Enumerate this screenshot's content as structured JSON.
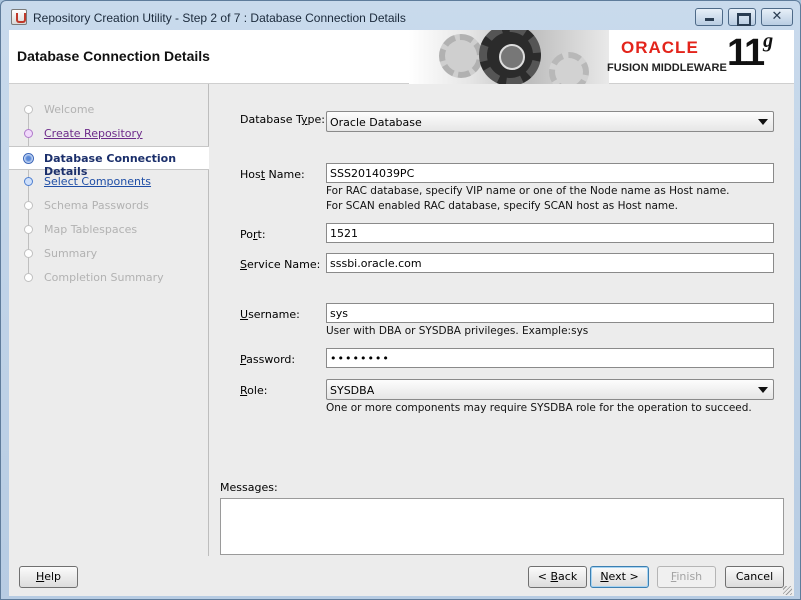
{
  "window": {
    "title": "Repository Creation Utility - Step 2 of 7 : Database Connection Details",
    "close_glyph": "✕"
  },
  "header": {
    "page_title": "Database Connection Details",
    "brand": "ORACLE",
    "product": "FUSION MIDDLEWARE",
    "version_major": "11",
    "version_suffix": "g"
  },
  "nav": {
    "items": [
      {
        "label": "Welcome",
        "state": "disabled"
      },
      {
        "label": "Create Repository",
        "state": "done"
      },
      {
        "label": "Database Connection Details",
        "state": "current"
      },
      {
        "label": "Select Components",
        "state": "next"
      },
      {
        "label": "Schema Passwords",
        "state": "disabled"
      },
      {
        "label": "Map Tablespaces",
        "state": "disabled"
      },
      {
        "label": "Summary",
        "state": "disabled"
      },
      {
        "label": "Completion Summary",
        "state": "disabled"
      }
    ]
  },
  "form": {
    "database_type": {
      "label_pre": "Database T",
      "label_mn": "y",
      "label_post": "pe:",
      "value": "Oracle Database"
    },
    "host_name": {
      "label_pre": "Hos",
      "label_mn": "t",
      "label_post": " Name:",
      "value": "SSS2014039PC",
      "hint1": "For RAC database, specify VIP name or one of the Node name as Host name.",
      "hint2": "For SCAN enabled RAC database, specify SCAN host as Host name."
    },
    "port": {
      "label_pre": "Po",
      "label_mn": "r",
      "label_post": "t:",
      "value": "1521"
    },
    "service_name": {
      "label_pre": "",
      "label_mn": "S",
      "label_post": "ervice Name:",
      "value": "sssbi.oracle.com"
    },
    "username": {
      "label_pre": "",
      "label_mn": "U",
      "label_post": "sername:",
      "value": "sys",
      "hint": "User with DBA or SYSDBA privileges. Example:sys"
    },
    "password": {
      "label_pre": "",
      "label_mn": "P",
      "label_post": "assword:",
      "value": "••••••••"
    },
    "role": {
      "label_pre": "",
      "label_mn": "R",
      "label_post": "ole:",
      "value": "SYSDBA",
      "hint": "One or more components may require SYSDBA role for the operation to succeed."
    },
    "messages_label": "Messages:"
  },
  "footer": {
    "help": {
      "pre": "",
      "mn": "H",
      "post": "elp"
    },
    "back": {
      "pre": "< ",
      "mn": "B",
      "post": "ack"
    },
    "next": {
      "pre": "",
      "mn": "N",
      "post": "ext >"
    },
    "finish": {
      "pre": "",
      "mn": "F",
      "post": "inish"
    },
    "cancel": {
      "pre": "Cancel",
      "mn": "",
      "post": ""
    }
  }
}
